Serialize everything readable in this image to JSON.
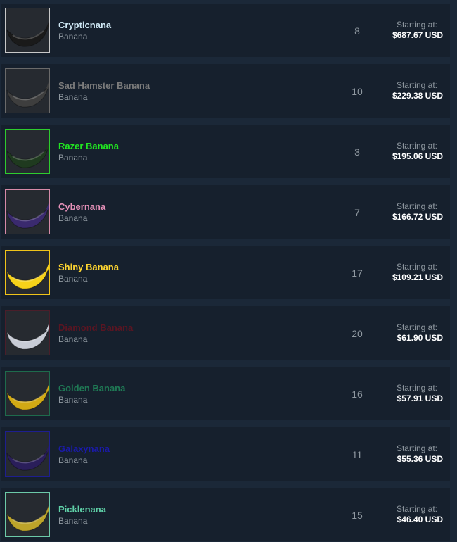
{
  "listings": [
    {
      "name": "Crypticnana",
      "game": "Banana",
      "quantity": "8",
      "price_label": "Starting at:",
      "price": "$687.67 USD",
      "name_color": "#cfe8f5",
      "border_color": "#c8c8c8",
      "banana_color": "#1a1a1a",
      "icon": "crypticnana-banana-icon"
    },
    {
      "name": "Sad Hamster Banana",
      "game": "Banana",
      "quantity": "10",
      "price_label": "Starting at:",
      "price": "$229.38 USD",
      "name_color": "#7b7b7b",
      "border_color": "#6a6a6a",
      "banana_color": "#3e3e3e",
      "icon": "sad-hamster-banana-icon"
    },
    {
      "name": "Razer Banana",
      "game": "Banana",
      "quantity": "3",
      "price_label": "Starting at:",
      "price": "$195.06 USD",
      "name_color": "#21e521",
      "border_color": "#2ecc2e",
      "banana_color": "#1f3a1f",
      "icon": "razer-banana-icon"
    },
    {
      "name": "Cybernana",
      "game": "Banana",
      "quantity": "7",
      "price_label": "Starting at:",
      "price": "$166.72 USD",
      "name_color": "#e691b9",
      "border_color": "#d68aa8",
      "banana_color": "#3a2a6e",
      "icon": "cybernana-banana-icon"
    },
    {
      "name": "Shiny Banana",
      "game": "Banana",
      "quantity": "17",
      "price_label": "Starting at:",
      "price": "$109.21 USD",
      "name_color": "#ffd630",
      "border_color": "#f0c419",
      "banana_color": "#f6d21a",
      "icon": "shiny-banana-icon"
    },
    {
      "name": "Diamond Banana",
      "game": "Banana",
      "quantity": "20",
      "price_label": "Starting at:",
      "price": "$61.90 USD",
      "name_color": "#5a1522",
      "border_color": "#4a1e2a",
      "banana_color": "#c8ccd6",
      "icon": "diamond-banana-icon"
    },
    {
      "name": "Golden Banana",
      "game": "Banana",
      "quantity": "16",
      "price_label": "Starting at:",
      "price": "$57.91 USD",
      "name_color": "#1f7a55",
      "border_color": "#1e6b4c",
      "banana_color": "#d1a914",
      "icon": "golden-banana-icon"
    },
    {
      "name": "Galaxynana",
      "game": "Banana",
      "quantity": "11",
      "price_label": "Starting at:",
      "price": "$55.36 USD",
      "name_color": "#1a1aa8",
      "border_color": "#1e1e8f",
      "banana_color": "#2a1e5a",
      "icon": "galaxynana-banana-icon"
    },
    {
      "name": "Picklenana",
      "game": "Banana",
      "quantity": "15",
      "price_label": "Starting at:",
      "price": "$46.40 USD",
      "name_color": "#5fd1a8",
      "border_color": "#6cc9a8",
      "banana_color": "#bda42a",
      "icon": "picklenana-banana-icon"
    }
  ]
}
